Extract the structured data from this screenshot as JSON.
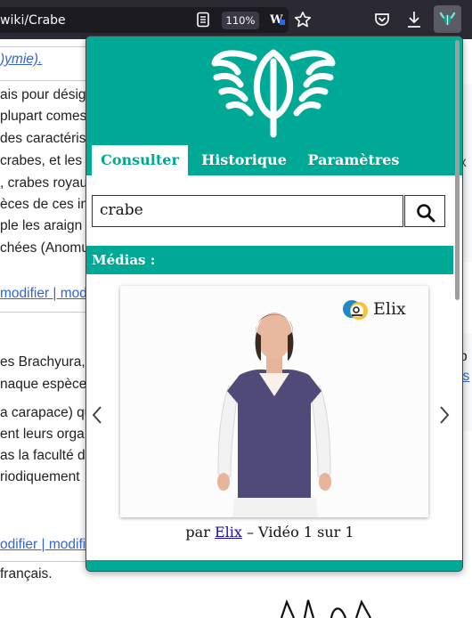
{
  "browser": {
    "url": "wiki/Crabe",
    "zoom": "110%",
    "icons": [
      "reader-view-icon",
      "extension-w-icon",
      "bookmark-star-icon",
      "pocket-icon",
      "download-icon",
      "extension-elix-icon"
    ]
  },
  "wiki": {
    "lines": [
      ")ymie).",
      "ais pour désig",
      "plupart comes",
      "des caractéris",
      " crabes, et les",
      ", crabes royau",
      "èces de ces in",
      "ple les araign",
      "chées (Anomu",
      "modifier | mod",
      "es Brachyura,",
      "naque espèce.",
      "a carapace) qu",
      "ent leurs orga",
      "as la faculté d",
      "riodiquement",
      "odifier | modifi",
      " français."
    ],
    "right_fragments": [
      "x",
      "b",
      "is"
    ]
  },
  "popup": {
    "tabs": [
      "Consulter",
      "Historique",
      "Paramètres"
    ],
    "search_value": "crabe",
    "section_title": "Médias :",
    "video": {
      "brand": "Elix",
      "caption_prefix": "par ",
      "caption_author": "Elix",
      "caption_suffix": " – Vidéo 1 sur 1"
    },
    "colors": {
      "accent": "#00a896",
      "toolbar": "#2b2a33"
    }
  }
}
